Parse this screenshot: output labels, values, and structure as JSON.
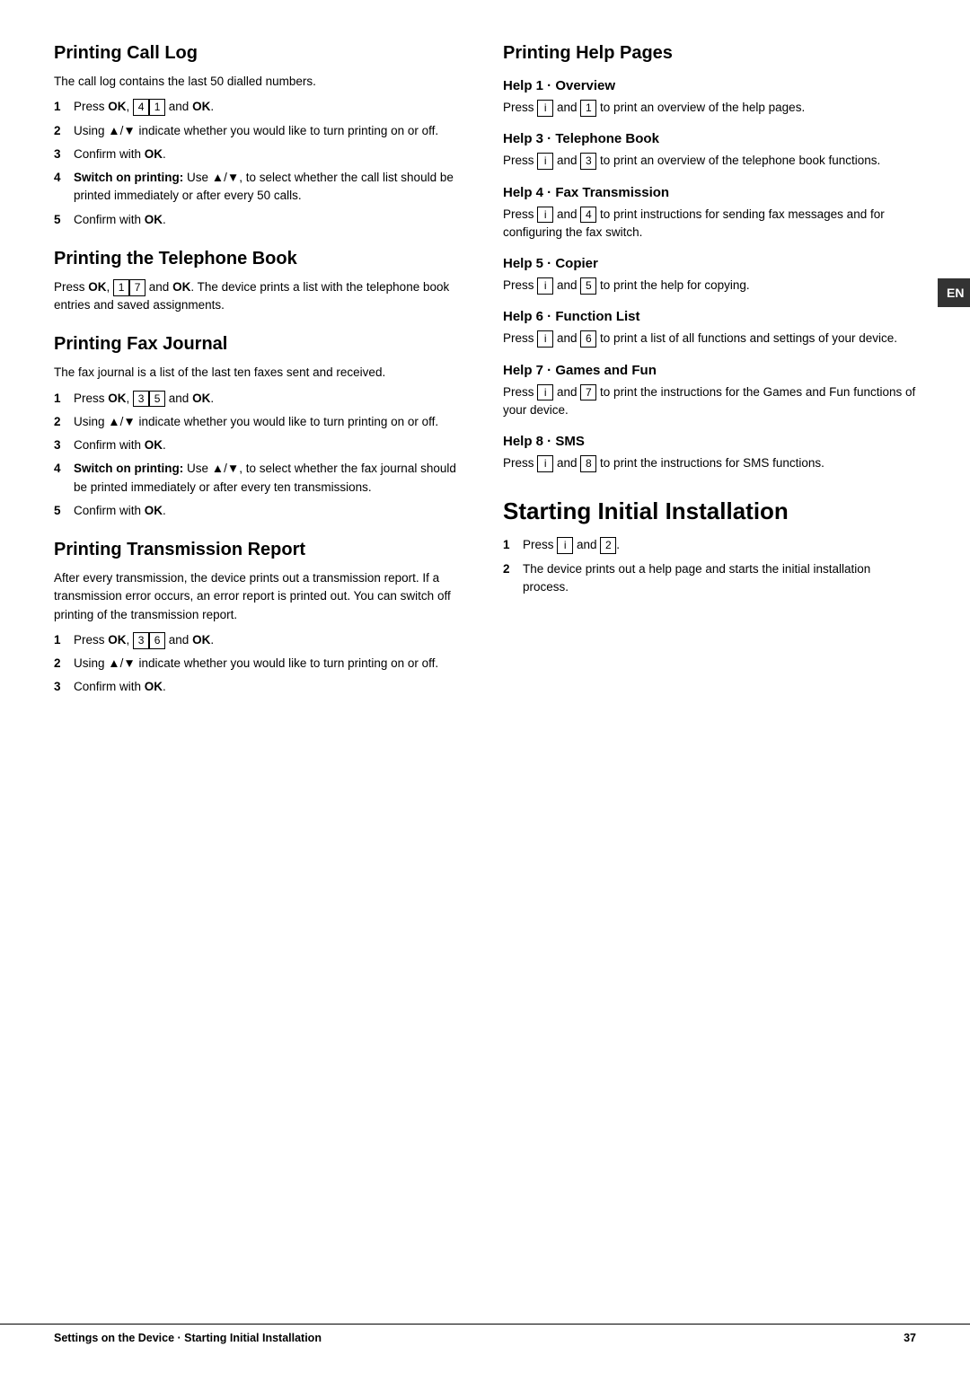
{
  "left_col": {
    "sections": [
      {
        "id": "printing-call-log",
        "title": "Printing Call Log",
        "intro": "The call log contains the last 50 dialled numbers.",
        "steps": [
          {
            "num": "1",
            "html": "Press <b>OK</b>, <kbd>4</kbd><kbd>1</kbd> and <b>OK</b>."
          },
          {
            "num": "2",
            "html": "Using ▲/▼ indicate whether you would like to turn printing on or off."
          },
          {
            "num": "3",
            "html": "Confirm with <b>OK</b>."
          },
          {
            "num": "4",
            "html": "<b>Switch on printing:</b> Use ▲/▼, to select whether the call list should be printed immediately or after every 50 calls."
          },
          {
            "num": "5",
            "html": "Confirm with <b>OK</b>."
          }
        ]
      },
      {
        "id": "printing-telephone-book",
        "title": "Printing the Telephone Book",
        "intro": "Press <b>OK</b>, <kbd>1</kbd><kbd>7</kbd> and <b>OK</b>. The device prints a list with the telephone book entries and saved assignments.",
        "steps": []
      },
      {
        "id": "printing-fax-journal",
        "title": "Printing Fax Journal",
        "intro": "The fax journal is a list of the last ten faxes sent and received.",
        "steps": [
          {
            "num": "1",
            "html": "Press <b>OK</b>, <kbd>3</kbd><kbd>5</kbd> and <b>OK</b>."
          },
          {
            "num": "2",
            "html": "Using ▲/▼ indicate whether you would like to turn printing on or off."
          },
          {
            "num": "3",
            "html": "Confirm with <b>OK</b>."
          },
          {
            "num": "4",
            "html": "<b>Switch on printing:</b> Use ▲/▼, to select whether the fax journal should be printed immediately or after every ten transmissions."
          },
          {
            "num": "5",
            "html": "Confirm with <b>OK</b>."
          }
        ]
      },
      {
        "id": "printing-transmission-report",
        "title": "Printing Transmission Report",
        "intro": "After every transmission, the device prints out a transmission report. If a transmission error occurs, an error report is printed out. You can switch off printing of the transmission report.",
        "steps": [
          {
            "num": "1",
            "html": "Press <b>OK</b>, <kbd>3</kbd><kbd>6</kbd> and <b>OK</b>."
          },
          {
            "num": "2",
            "html": "Using ▲/▼ indicate whether you would like to turn printing on or off."
          },
          {
            "num": "3",
            "html": "Confirm with <b>OK</b>."
          }
        ]
      }
    ]
  },
  "right_col": {
    "sections": [
      {
        "id": "printing-help-pages",
        "title": "Printing Help Pages",
        "subsections": [
          {
            "id": "help1",
            "title": "Help 1 · Overview",
            "text": "Press <kbd>i</kbd> and <kbd>1</kbd> to print an overview of the help pages."
          },
          {
            "id": "help3",
            "title": "Help 3 · Telephone Book",
            "text": "Press <kbd>i</kbd> and <kbd>3</kbd> to print an overview of the telephone book functions."
          },
          {
            "id": "help4",
            "title": "Help 4 · Fax Transmission",
            "text": "Press <kbd>i</kbd> and <kbd>4</kbd> to print instructions for sending fax messages and for configuring the fax switch."
          },
          {
            "id": "help5",
            "title": "Help 5 · Copier",
            "text": "Press <kbd>i</kbd> and <kbd>5</kbd> to print the help for copying."
          },
          {
            "id": "help6",
            "title": "Help 6 · Function List",
            "text": "Press <kbd>i</kbd> and <kbd>6</kbd> to print a list of all functions and settings of your device."
          },
          {
            "id": "help7",
            "title": "Help 7 · Games and Fun",
            "text": "Press <kbd>i</kbd> and <kbd>7</kbd> to print the instructions for the Games and Fun functions of your device."
          },
          {
            "id": "help8",
            "title": "Help 8 · SMS",
            "text": "Press <kbd>i</kbd> and <kbd>8</kbd> to print the instructions for SMS functions."
          }
        ]
      },
      {
        "id": "starting-initial-installation",
        "title": "Starting Initial Installation",
        "steps": [
          {
            "num": "1",
            "html": "Press <kbd>i</kbd> and <kbd>2</kbd>."
          },
          {
            "num": "2",
            "html": "The device prints out a help page and starts the initial installation process."
          }
        ]
      }
    ]
  },
  "en_tab": "EN",
  "footer": {
    "left": "Settings on the Device · Starting Initial Installation",
    "right": "37"
  }
}
